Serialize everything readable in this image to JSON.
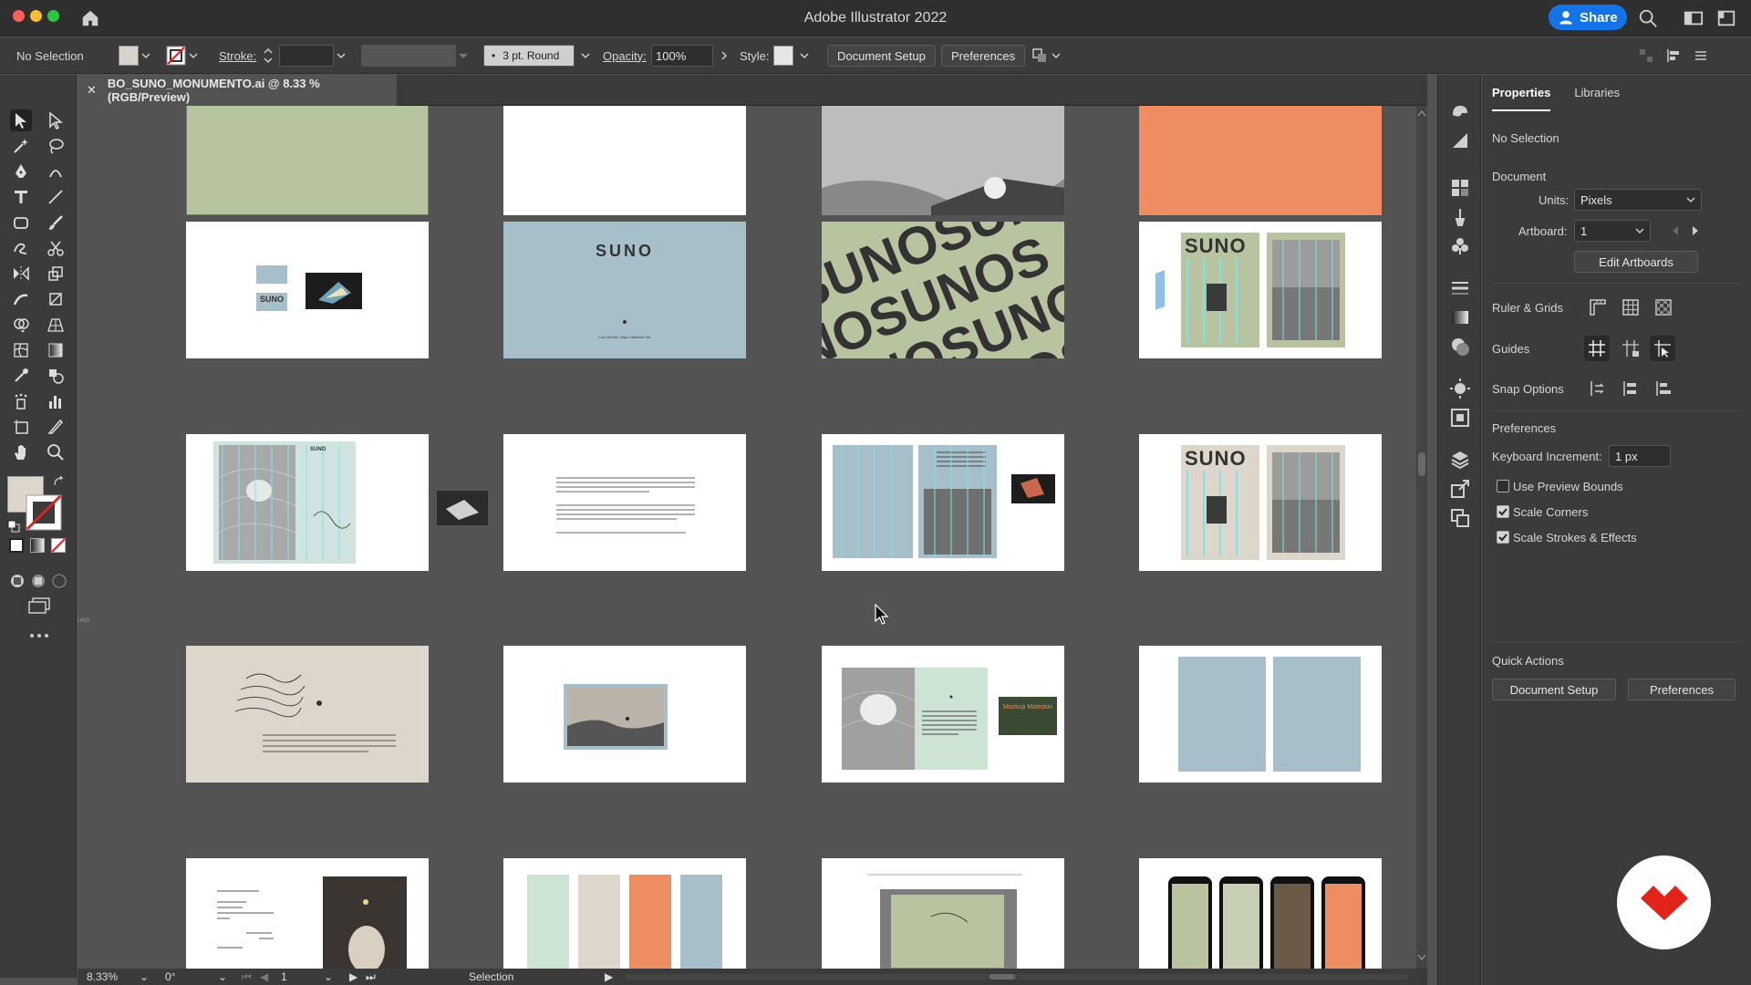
{
  "window": {
    "title": "Adobe Illustrator 2022",
    "share_label": "Share"
  },
  "controlbar": {
    "selection": "No Selection",
    "stroke_label": "Stroke:",
    "brush_label": "3 pt. Round",
    "opacity_label": "Opacity:",
    "opacity_value": "100%",
    "style_label": "Style:",
    "document_setup": "Document Setup",
    "preferences": "Preferences"
  },
  "document": {
    "tab_title": "BO_SUNO_MONUMENTO.ai @ 8.33 % (RGB/Preview)"
  },
  "artboards": {
    "suno_logo": "SUNO",
    "address": "Los Cerritos, Baja California Sur",
    "mockup_note": "Mockup Moleskin",
    "edge_label": "UNG"
  },
  "statusbar": {
    "zoom": "8.33%",
    "rotation": "0°",
    "artboard": "1",
    "tool": "Selection"
  },
  "properties": {
    "tabs": [
      "Properties",
      "Libraries"
    ],
    "no_selection": "No Selection",
    "document_header": "Document",
    "units_label": "Units:",
    "units_value": "Pixels",
    "artboard_label": "Artboard:",
    "artboard_value": "1",
    "edit_artboards": "Edit Artboards",
    "ruler_grids": "Ruler & Grids",
    "guides": "Guides",
    "snap_options": "Snap Options",
    "preferences_header": "Preferences",
    "keyboard_increment_label": "Keyboard Increment:",
    "keyboard_increment_value": "1 px",
    "use_preview_bounds": "Use Preview Bounds",
    "scale_corners": "Scale Corners",
    "scale_strokes": "Scale Strokes & Effects",
    "quick_actions": "Quick Actions",
    "qa_document_setup": "Document Setup",
    "qa_preferences": "Preferences"
  },
  "colors": {
    "accent": "#1473e6",
    "sage": "#b8c4a0",
    "blue": "#a7bfc9",
    "orange": "#ef8d62",
    "cream": "#ddd6ca"
  }
}
